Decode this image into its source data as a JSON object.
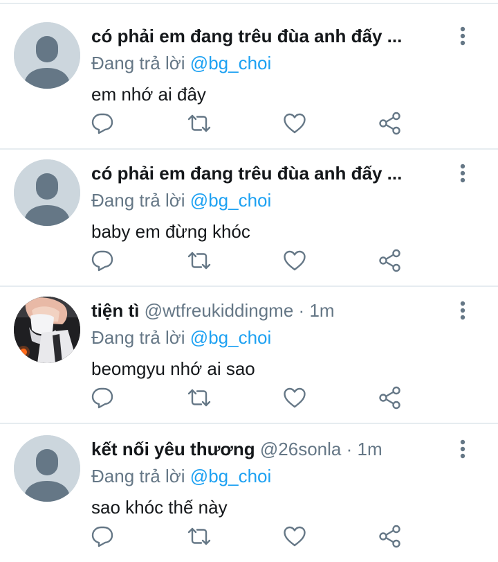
{
  "reply_prefix": "Đang trả lời",
  "tweets": [
    {
      "name": "có phải em đang trêu đùa anh đấy ...",
      "handle": "",
      "dot": "",
      "time": "",
      "reply_to": "@bg_choi",
      "text": "em nhớ ai đây",
      "avatar": "default-avatar-icon"
    },
    {
      "name": "có phải em đang trêu đùa anh đấy ...",
      "handle": "",
      "dot": "",
      "time": "",
      "reply_to": "@bg_choi",
      "text": "baby em đừng khóc",
      "avatar": "default-avatar-icon"
    },
    {
      "name": "tiện tì",
      "handle": "@wtfreukiddingme",
      "dot": "·",
      "time": "1m",
      "reply_to": "@bg_choi",
      "text": "beomgyu nhớ ai sao",
      "avatar": "photo-avatar"
    },
    {
      "name": "kết nối yêu thương",
      "handle": "@26sonla",
      "dot": "·",
      "time": "1m",
      "reply_to": "@bg_choi",
      "text": "sao khóc thế này",
      "avatar": "default-avatar-icon"
    }
  ],
  "icons": {
    "reply": "reply-icon",
    "retweet": "retweet-icon",
    "like": "like-icon",
    "share": "share-icon",
    "more": "more-options-icon"
  },
  "colors": {
    "text": "#14171a",
    "secondary": "#657786",
    "mention": "#1da1f2",
    "divider": "#e6ecf0",
    "avatar_bg": "#ccd6dd",
    "avatar_figure": "#657786"
  }
}
